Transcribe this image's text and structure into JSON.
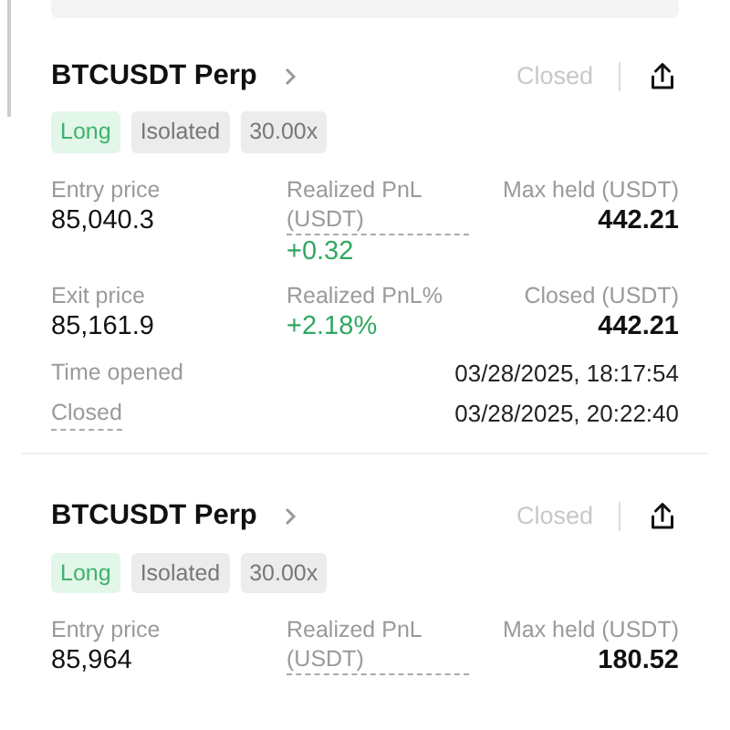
{
  "cards": [
    {
      "title": "BTCUSDT Perp",
      "status": "Closed",
      "tags": [
        {
          "label": "Long",
          "kind": "side"
        },
        {
          "label": "Isolated",
          "kind": "plain"
        },
        {
          "label": "30.00x",
          "kind": "plain"
        }
      ],
      "metric_rows": [
        [
          {
            "label": "Entry price",
            "value": "85,040.3",
            "color": "#111111",
            "dashed": false
          },
          {
            "label": "Realized PnL (USDT)",
            "value": "+0.32",
            "color": "#2fa860",
            "dashed": true
          },
          {
            "label": "Max held (USDT)",
            "value": "442.21",
            "color": "#111111",
            "dashed": false
          }
        ],
        [
          {
            "label": "Exit price",
            "value": "85,161.9",
            "color": "#111111",
            "dashed": false
          },
          {
            "label": "Realized PnL%",
            "value": "+2.18%",
            "color": "#2fa860",
            "dashed": false
          },
          {
            "label": "Closed (USDT)",
            "value": "442.21",
            "color": "#111111",
            "dashed": false
          }
        ]
      ],
      "times": [
        {
          "label": "Time opened",
          "value": "03/28/2025, 18:17:54",
          "dashed": false
        },
        {
          "label": "Closed",
          "value": "03/28/2025, 20:22:40",
          "dashed": true
        }
      ]
    },
    {
      "title": "BTCUSDT Perp",
      "status": "Closed",
      "tags": [
        {
          "label": "Long",
          "kind": "side"
        },
        {
          "label": "Isolated",
          "kind": "plain"
        },
        {
          "label": "30.00x",
          "kind": "plain"
        }
      ],
      "metric_rows": [
        [
          {
            "label": "Entry price",
            "value": "85,964",
            "color": "#111111",
            "dashed": false
          },
          {
            "label": "Realized PnL (USDT)",
            "dashed": true
          },
          {
            "label": "Max held (USDT)",
            "value": "180.52",
            "color": "#111111",
            "dashed": false
          }
        ]
      ]
    }
  ]
}
